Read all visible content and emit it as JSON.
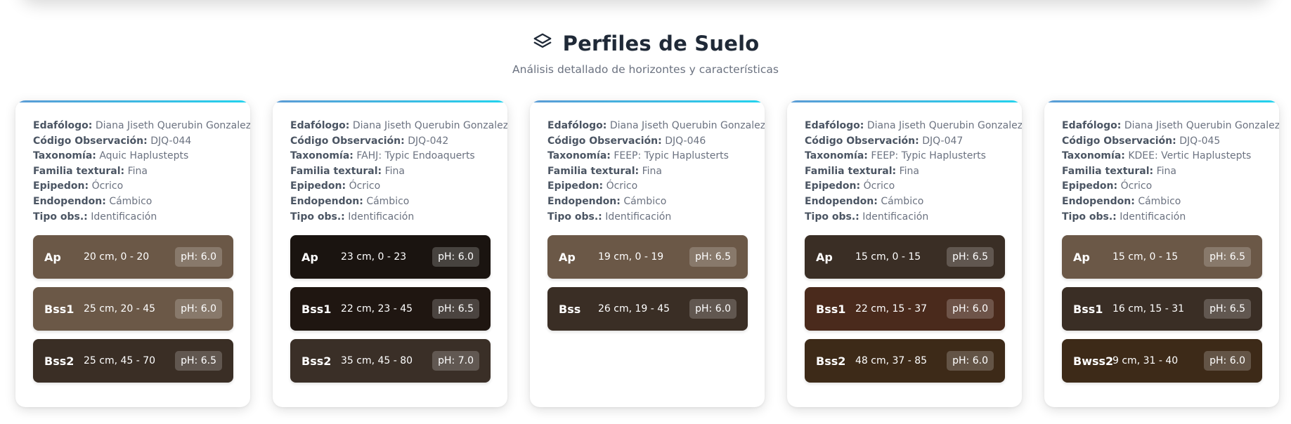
{
  "header": {
    "title": "Perfiles de Suelo",
    "subtitle": "Análisis detallado de horizontes y características",
    "icon": "layers-icon"
  },
  "labels": {
    "edafologo": "Edafólogo:",
    "codigo": "Código Observación:",
    "taxonomia": "Taxonomía:",
    "familia": "Familia textural:",
    "epipedon": "Epipedon:",
    "endopedon": "Endopendon:",
    "tipo": "Tipo obs.:"
  },
  "colors": {
    "accent_gradient_start": "#5b9bd5",
    "accent_gradient_end": "#22d3ee",
    "brown_light": "#6b5847",
    "brown_dark": "#3a2e25",
    "brown_black": "#1a1410",
    "brown_red": "#4a2a1c",
    "brown_olive": "#3d2a18"
  },
  "profiles": [
    {
      "edafologo": "Diana Jiseth Querubin Gonzalez",
      "codigo": "DJQ-044",
      "taxonomia": "Aquic Haplustepts",
      "familia": "Fina",
      "epipedon": "Ócrico",
      "endopedon": "Cámbico",
      "tipo": "Identificación",
      "horizons": [
        {
          "name": "Ap",
          "depth": "20 cm, 0 - 20",
          "ph": "pH: 6.0",
          "color": "#6b5847"
        },
        {
          "name": "Bss1",
          "depth": "25 cm, 20 - 45",
          "ph": "pH: 6.0",
          "color": "#6b5847"
        },
        {
          "name": "Bss2",
          "depth": "25 cm, 45 - 70",
          "ph": "pH: 6.5",
          "color": "#3a2e25"
        }
      ]
    },
    {
      "edafologo": "Diana Jiseth Querubin Gonzalez",
      "codigo": "DJQ-042",
      "taxonomia": "FAHJ: Typic Endoaquerts",
      "familia": "Fina",
      "epipedon": "Ócrico",
      "endopedon": "Cámbico",
      "tipo": "Identificación",
      "horizons": [
        {
          "name": "Ap",
          "depth": "23 cm, 0 - 23",
          "ph": "pH: 6.0",
          "color": "#1a1410"
        },
        {
          "name": "Bss1",
          "depth": "22 cm, 23 - 45",
          "ph": "pH: 6.5",
          "color": "#1f1611"
        },
        {
          "name": "Bss2",
          "depth": "35 cm, 45 - 80",
          "ph": "pH: 7.0",
          "color": "#3a2f27"
        }
      ]
    },
    {
      "edafologo": "Diana Jiseth Querubin Gonzalez",
      "codigo": "DJQ-046",
      "taxonomia": "FEEP: Typic Haplusterts",
      "familia": "Fina",
      "epipedon": "Ócrico",
      "endopedon": "Cámbico",
      "tipo": "Identificación",
      "horizons": [
        {
          "name": "Ap",
          "depth": "19 cm, 0 - 19",
          "ph": "pH: 6.5",
          "color": "#6b5847"
        },
        {
          "name": "Bss",
          "depth": "26 cm, 19 - 45",
          "ph": "pH: 6.0",
          "color": "#3a2e25"
        }
      ]
    },
    {
      "edafologo": "Diana Jiseth Querubin Gonzalez",
      "codigo": "DJQ-047",
      "taxonomia": "FEEP: Typic Haplusterts",
      "familia": "Fina",
      "epipedon": "Ócrico",
      "endopedon": "Cámbico",
      "tipo": "Identificación",
      "horizons": [
        {
          "name": "Ap",
          "depth": "15 cm, 0 - 15",
          "ph": "pH: 6.5",
          "color": "#3a2e25"
        },
        {
          "name": "Bss1",
          "depth": "22 cm, 15 - 37",
          "ph": "pH: 6.0",
          "color": "#4a2a1c"
        },
        {
          "name": "Bss2",
          "depth": "48 cm, 37 - 85",
          "ph": "pH: 6.0",
          "color": "#3d2a18"
        }
      ]
    },
    {
      "edafologo": "Diana Jiseth Querubin Gonzalez",
      "codigo": "DJQ-045",
      "taxonomia": "KDEE: Vertic Haplustepts",
      "familia": "Fina",
      "epipedon": "Ócrico",
      "endopedon": "Cámbico",
      "tipo": "Identificación",
      "horizons": [
        {
          "name": "Ap",
          "depth": "15 cm, 0 - 15",
          "ph": "pH: 6.5",
          "color": "#6b5847"
        },
        {
          "name": "Bss1",
          "depth": "16 cm, 15 - 31",
          "ph": "pH: 6.5",
          "color": "#3a2e25"
        },
        {
          "name": "Bwss2",
          "depth": "9 cm, 31 - 40",
          "ph": "pH: 6.0",
          "color": "#3d2a18"
        }
      ]
    }
  ]
}
